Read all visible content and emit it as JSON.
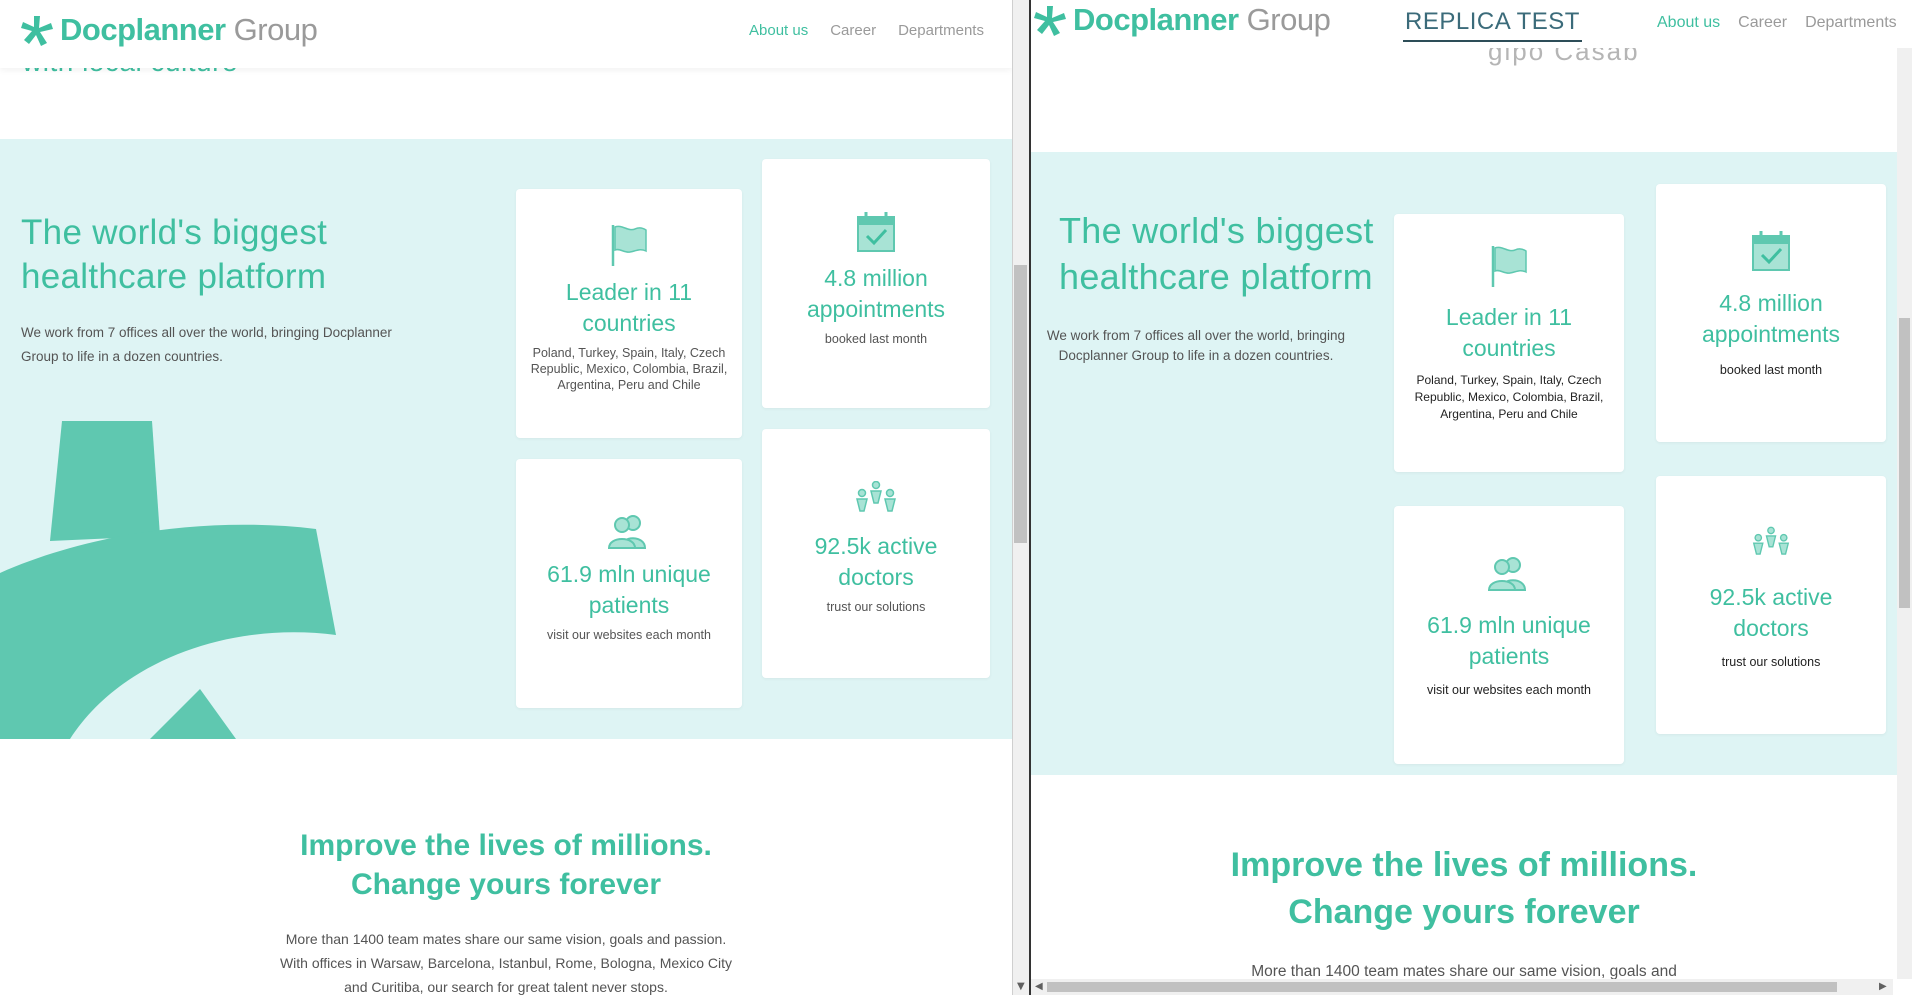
{
  "left": {
    "logo": {
      "brand": "Docplanner",
      "suffix": "Group"
    },
    "nav": [
      {
        "label": "About us",
        "active": true
      },
      {
        "label": "Career",
        "active": false
      },
      {
        "label": "Departments",
        "active": false
      }
    ],
    "cut_text": "with local culture",
    "band": {
      "title_line1": "The world's biggest",
      "title_line2": "healthcare platform",
      "desc": "We work from 7 offices all over the world, bringing Docplanner Group to life in a dozen countries."
    },
    "cards": [
      {
        "icon": "flag-icon",
        "stat": "Leader in 11 countries",
        "sub": "Poland, Turkey, Spain, Italy, Czech Republic, Mexico, Colombia, Brazil, Argentina, Peru and Chile"
      },
      {
        "icon": "calendar-check-icon",
        "stat": "4.8 million appointments",
        "sub": "booked last month"
      },
      {
        "icon": "patients-icon",
        "stat": "61.9 mln unique patients",
        "sub": "visit our websites each month"
      },
      {
        "icon": "doctors-icon",
        "stat": "92.5k active doctors",
        "sub": "trust our solutions"
      }
    ],
    "improve": {
      "line1": "Improve the lives of millions.",
      "line2": "Change yours forever",
      "text1": "More than 1400 team mates share our same vision, goals and passion.",
      "text2": "With offices in Warsaw, Barcelona, Istanbul, Rome, Bologna, Mexico City",
      "text3": "and Curitiba, our search for great talent never stops."
    }
  },
  "right": {
    "logo": {
      "brand": "Docplanner",
      "suffix": "Group"
    },
    "replica_label": "REPLICA TEST",
    "nav": [
      {
        "label": "About us",
        "active": true
      },
      {
        "label": "Career",
        "active": false
      },
      {
        "label": "Departments",
        "active": false
      }
    ],
    "cut_text": "gipo  Casab",
    "band": {
      "title_line1": "The world's biggest",
      "title_line2": "healthcare platform",
      "desc_line1": "We work from 7 offices all over the world, bringing",
      "desc_line2": "Docplanner Group to life in a dozen countries."
    },
    "cards": [
      {
        "icon": "flag-icon",
        "stat": "Leader in 11 countries",
        "sub": "Poland, Turkey, Spain, Italy, Czech Republic, Mexico, Colombia, Brazil, Argentina, Peru and Chile"
      },
      {
        "icon": "calendar-check-icon",
        "stat": "4.8 million appointments",
        "sub": "booked last month"
      },
      {
        "icon": "patients-icon",
        "stat": "61.9 mln unique patients",
        "sub": "visit our websites each month"
      },
      {
        "icon": "doctors-icon",
        "stat": "92.5k active doctors",
        "sub": "trust our solutions"
      }
    ],
    "improve": {
      "line1": "Improve the lives of millions.",
      "line2": "Change yours forever",
      "text1": "More than 1400 team mates share our same vision, goals and"
    }
  },
  "colors": {
    "accent": "#3fbfa0",
    "band": "#def4f4",
    "text": "#545454",
    "nav": "#9a9a9a"
  }
}
